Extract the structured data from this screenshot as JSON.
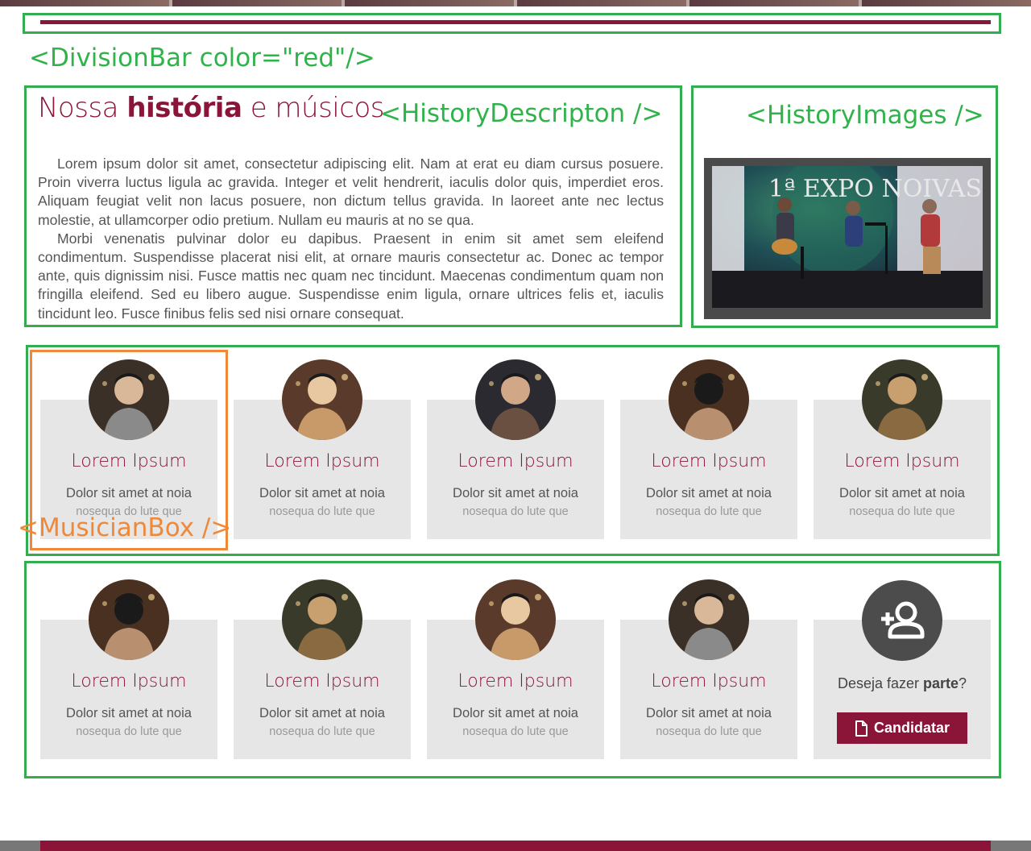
{
  "annotations": {
    "division_bar": "<DivisionBar color=\"red\"/>",
    "history_description": "<HistoryDescripton />",
    "history_images": "<HistoryImages />",
    "musician_box": "<MusicianBox />"
  },
  "history": {
    "title_pre": "Nossa ",
    "title_bold": "história",
    "title_post": " e músicos",
    "paragraphs": [
      "Lorem ipsum dolor sit amet, consectetur adipiscing elit. Nam at erat eu diam cursus posuere. Proin viverra luctus ligula ac gravida. Integer et velit hendrerit, iaculis dolor quis, imperdiet eros. Aliquam feugiat velit non lacus posuere, non dictum tellus gravida. In laoreet ante nec lectus molestie, at ullamcorper odio pretium. Nullam eu mauris at no se qua.",
      "Morbi venenatis pulvinar dolor eu dapibus. Praesent in enim sit amet sem eleifend condimentum. Suspendisse placerat nisi elit, at ornare mauris consectetur ac. Donec ac tempor ante, quis dignissim nisi. Fusce mattis nec quam nec tincidunt. Maecenas condimentum quam non fringilla eleifend. Sed eu libero augue. Suspendisse enim ligula, ornare ultrices felis et, iaculis tincidunt leo. Fusce finibus felis sed nisi ornare consequat."
    ],
    "photo_banner": "1ª EXPO NOIVAS"
  },
  "musicians": [
    {
      "name": "Lorem Ipsum",
      "line1": "Dolor sit amet at noia",
      "line2": "nosequa do lute que"
    },
    {
      "name": "Lorem Ipsum",
      "line1": "Dolor sit amet at noia",
      "line2": "nosequa do lute que"
    },
    {
      "name": "Lorem Ipsum",
      "line1": "Dolor sit amet at noia",
      "line2": "nosequa do lute que"
    },
    {
      "name": "Lorem Ipsum",
      "line1": "Dolor sit amet at noia",
      "line2": "nosequa do lute que"
    },
    {
      "name": "Lorem Ipsum",
      "line1": "Dolor sit amet at noia",
      "line2": "nosequa do lute que"
    },
    {
      "name": "Lorem Ipsum",
      "line1": "Dolor sit amet at noia",
      "line2": "nosequa do lute que"
    },
    {
      "name": "Lorem Ipsum",
      "line1": "Dolor sit amet at noia",
      "line2": "nosequa do lute que"
    },
    {
      "name": "Lorem Ipsum",
      "line1": "Dolor sit amet at noia",
      "line2": "nosequa do lute que"
    },
    {
      "name": "Lorem Ipsum",
      "line1": "Dolor sit amet at noia",
      "line2": "nosequa do lute que"
    }
  ],
  "join": {
    "text_pre": "Deseja fazer ",
    "text_bold": "parte",
    "text_post": "?",
    "button_label": "Candidatar",
    "icon": "person-add-icon",
    "button_icon": "document-icon"
  },
  "colors": {
    "brand": "#8b1538",
    "annotation_green": "#32ad4f",
    "annotation_orange": "#f0883a",
    "card_bg": "#e6e6e6"
  }
}
